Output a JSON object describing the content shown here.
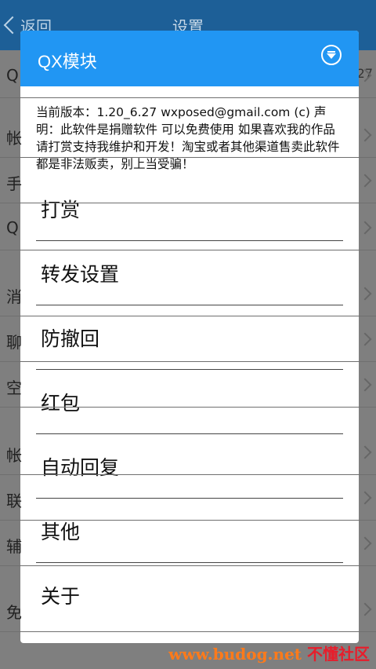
{
  "background": {
    "back_label": "返回",
    "title": "设置",
    "right_text": "27",
    "row_chars": [
      "Q",
      "帐",
      "手",
      "Q",
      "消",
      "聊",
      "空",
      "帐",
      "联",
      "辅",
      "免"
    ]
  },
  "dialog": {
    "title": "QX模块",
    "info": "当前版本：1.20_6.27 wxposed@gmail.com (c) 声明：此软件是捐赠软件 可以免费使用 如果喜欢我的作品请打赏支持我维护和开发！淘宝或者其他渠道售卖此软件都是非法贩卖，别上当受骗！",
    "items": [
      {
        "label": "打赏"
      },
      {
        "label": "转发设置"
      },
      {
        "label": "防撤回"
      },
      {
        "label": "红包"
      },
      {
        "label": "自动回复"
      },
      {
        "label": "其他"
      },
      {
        "label": "关于"
      }
    ]
  },
  "watermark": {
    "url": "www.budog.net",
    "cn": "不懂社区"
  }
}
